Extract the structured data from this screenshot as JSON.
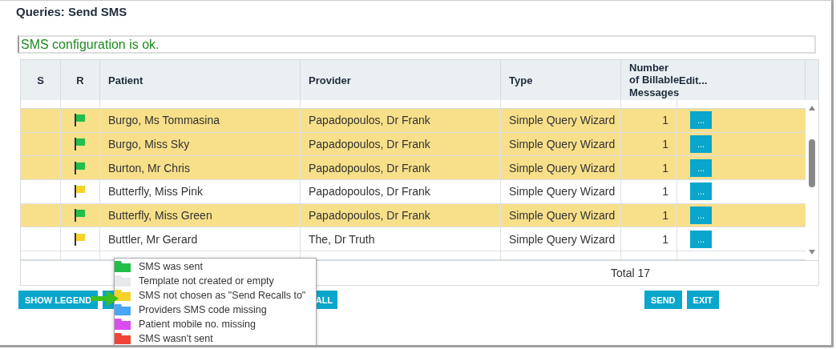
{
  "title": "Queries: Send SMS",
  "status": {
    "value": "SMS configuration is ok."
  },
  "table": {
    "columns": [
      "S",
      "R",
      "Patient",
      "Provider",
      "Type",
      "Number of Billable Messages",
      "Edit..."
    ],
    "rows": [
      {
        "color": "#1fbf4a",
        "selected": true,
        "patient": "Burgo, Ms Tommasina",
        "provider": "Papadopoulos, Dr Frank",
        "type": "Simple Query Wizard",
        "count": "1",
        "edit": "..."
      },
      {
        "color": "#1fbf4a",
        "selected": true,
        "patient": "Burgo, Miss Sky",
        "provider": "Papadopoulos, Dr Frank",
        "type": "Simple Query Wizard",
        "count": "1",
        "edit": "..."
      },
      {
        "color": "#1fbf4a",
        "selected": true,
        "patient": "Burton, Mr Chris",
        "provider": "Papadopoulos, Dr Frank",
        "type": "Simple Query Wizard",
        "count": "1",
        "edit": "..."
      },
      {
        "color": "#f5d327",
        "selected": false,
        "patient": "Butterfly, Miss Pink",
        "provider": "Papadopoulos, Dr Frank",
        "type": "Simple Query Wizard",
        "count": "1",
        "edit": "..."
      },
      {
        "color": "#1fbf4a",
        "selected": true,
        "patient": "Butterfly, Miss Green",
        "provider": "Papadopoulos, Dr Frank",
        "type": "Simple Query Wizard",
        "count": "1",
        "edit": "..."
      },
      {
        "color": "#f5d327",
        "selected": false,
        "patient": "Buttler, Mr Gerard",
        "provider": "The, Dr Truth",
        "type": "Simple Query Wizard",
        "count": "1",
        "edit": "..."
      }
    ],
    "total": "Total 17"
  },
  "buttons": {
    "show_legend": "SHOW LEGEND",
    "hidden_button": "ALL",
    "send": "SEND",
    "exit": "EXIT"
  },
  "legend": [
    {
      "color": "#1fbf4a",
      "label": "SMS was sent"
    },
    {
      "color": "#e6e8ea",
      "label": "Template not created or empty"
    },
    {
      "color": "#f5d327",
      "label": "SMS not chosen as \"Send Recalls to\""
    },
    {
      "color": "#47a6f5",
      "label": "Providers SMS code missing"
    },
    {
      "color": "#d94cf0",
      "label": "Patient mobile no. missing"
    },
    {
      "color": "#f04438",
      "label": "SMS wasn't sent"
    }
  ]
}
